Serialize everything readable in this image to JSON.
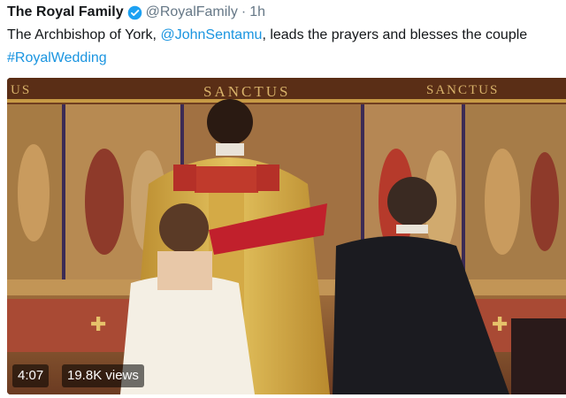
{
  "tweet": {
    "display_name": "The Royal Family",
    "verified_icon": "verified-badge-icon",
    "handle": "@RoyalFamily",
    "separator": "·",
    "time": "1h",
    "text_before_mention": "The Archbishop of York, ",
    "mention": "@JohnSentamu",
    "text_after_mention": ", leads the prayers and blesses the couple",
    "hashtag": "#RoyalWedding"
  },
  "video": {
    "banner_left": "US",
    "banner_center": "SANCTUS",
    "banner_right": "SANCTUS",
    "duration": "4:07",
    "views": "19.8K views"
  },
  "colors": {
    "link": "#1b95e0",
    "verified": "#1da1f2",
    "text": "#14171a",
    "secondary": "#657786"
  }
}
